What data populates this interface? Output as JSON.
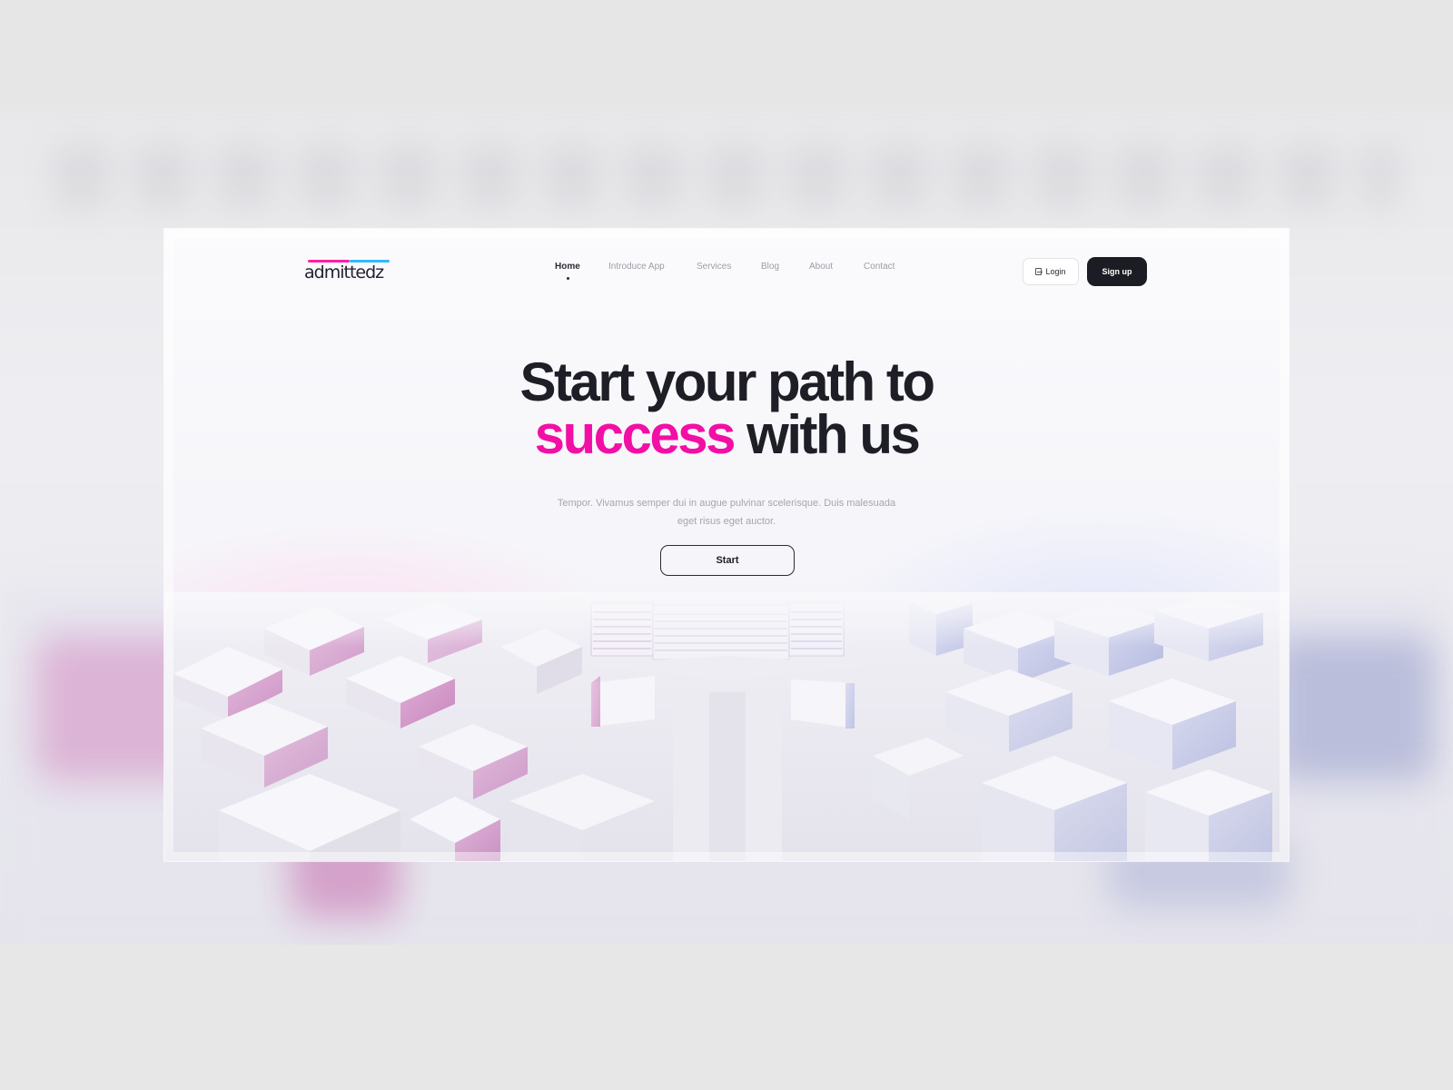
{
  "brand": {
    "name": "admittedz",
    "accent_pink": "#f20fa5",
    "accent_cyan": "#2fb9ff",
    "dark": "#1b1c24"
  },
  "nav": {
    "items": [
      {
        "label": "Home",
        "active": true
      },
      {
        "label": "Introduce App",
        "active": false
      },
      {
        "label": "Services",
        "active": false
      },
      {
        "label": "Blog",
        "active": false
      },
      {
        "label": "About",
        "active": false
      },
      {
        "label": "Contact",
        "active": false
      }
    ]
  },
  "header": {
    "login_label": "Login",
    "login_icon": "login-icon",
    "signup_label": "Sign up"
  },
  "hero": {
    "title_line1": "Start your path to",
    "title_accent": "success",
    "title_rest": " with us",
    "subtitle": "Tempor. Vivamus semper dui in augue pulvinar scelerisque. Duis malesuada eget risus eget auctor.",
    "cta_label": "Start"
  }
}
